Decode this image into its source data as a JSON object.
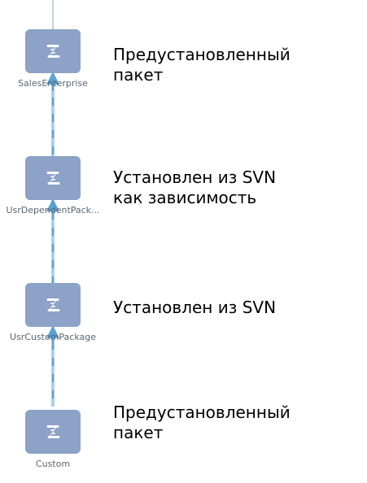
{
  "colors": {
    "node_fill": "#8ca2c7",
    "icon": "#ffffff",
    "connector": "#5aa2d6",
    "top_line": "#9aa0a6",
    "label": "#5b6770",
    "note": "#000000"
  },
  "nodes": [
    {
      "label": "SalesEnterprise",
      "icon": "package-scroll-icon",
      "note": "Предустановленный\nпакет"
    },
    {
      "label": "UsrDependentPack...",
      "icon": "package-scroll-icon",
      "note": "Установлен из SVN\nкак зависимость"
    },
    {
      "label": "UsrCustomPackage",
      "icon": "package-scroll-icon",
      "note": "Установлен из SVN"
    },
    {
      "label": "Custom",
      "icon": "package-scroll-icon",
      "note": "Предустановленный\nпакет"
    }
  ]
}
